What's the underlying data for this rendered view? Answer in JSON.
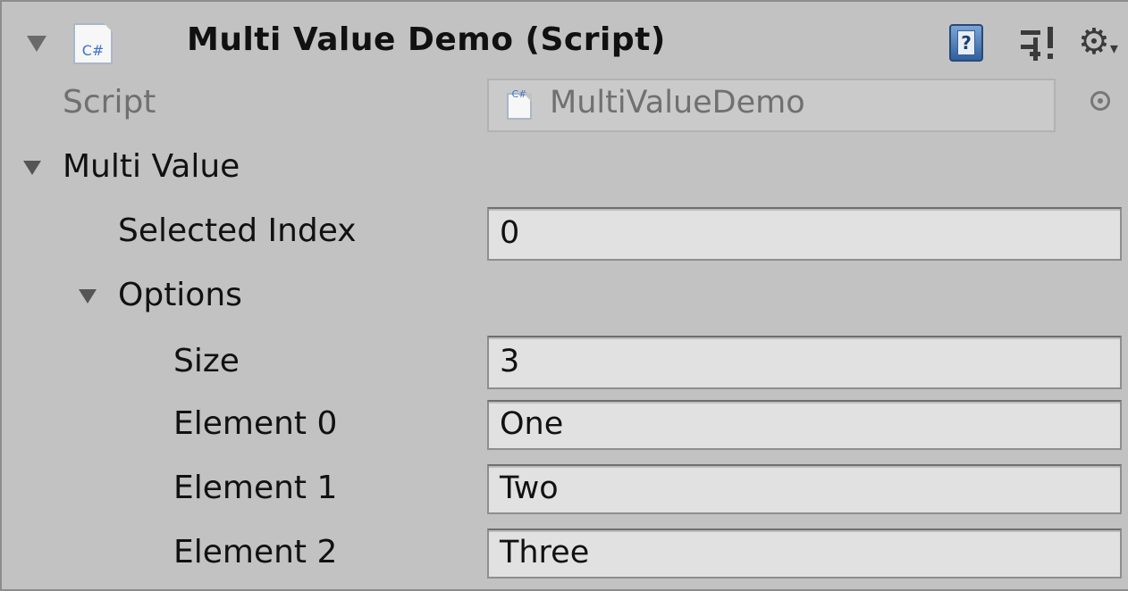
{
  "component": {
    "title": "Multi Value Demo (Script)",
    "icon_text": "C#",
    "help_icon_text": "?",
    "gear_glyph": "⚙"
  },
  "script_row": {
    "label": "Script",
    "value": "MultiValueDemo",
    "icon_text": "C#"
  },
  "multi_value": {
    "label": "Multi Value",
    "selected_index": {
      "label": "Selected Index",
      "value": "0"
    },
    "options": {
      "label": "Options",
      "size": {
        "label": "Size",
        "value": "3"
      },
      "elements": [
        {
          "label": "Element 0",
          "value": "One"
        },
        {
          "label": "Element 1",
          "value": "Two"
        },
        {
          "label": "Element 2",
          "value": "Three"
        }
      ]
    }
  },
  "colors": {
    "panel_bg": "#c2c2c2",
    "field_bg": "#e1e1e1",
    "disabled_text": "#707070",
    "script_icon_blue": "#3f73c7"
  }
}
